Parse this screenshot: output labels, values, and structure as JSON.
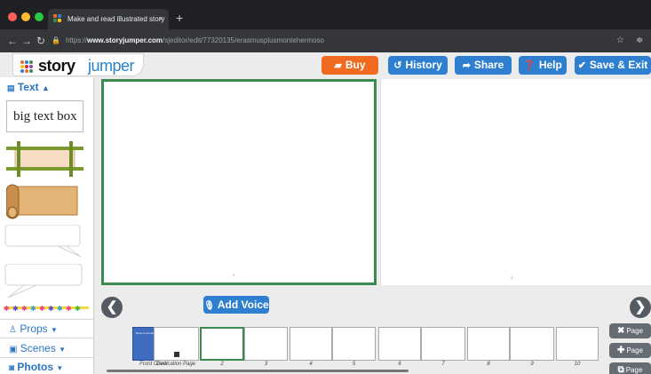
{
  "browser": {
    "tab_title": "Make and read illustrated story",
    "tab_close": "×",
    "new_tab": "+",
    "url_scheme": "https://",
    "url_host": "www.storyjumper.com",
    "url_path": "/sjeditor/edit/77320135/erasmusplusmontehermoso",
    "colors": {
      "close": "#ff5f57",
      "minimize": "#febc2e",
      "maximize": "#28c840"
    }
  },
  "header": {
    "logo_story": "story",
    "logo_jumper": "jumper",
    "buy": "Buy",
    "history": "History",
    "share": "Share",
    "help": "Help",
    "save_exit": "Save & Exit"
  },
  "palette": {
    "text_header": "Text",
    "text_box_sample": "big text box",
    "props": "Props",
    "scenes": "Scenes",
    "photos": "Photos"
  },
  "editor": {
    "left_page_number": "2",
    "right_page_number": "3",
    "add_voice": "Add Voice"
  },
  "thumbnails": {
    "cover_title": "Book of proverbs and sayings",
    "labels": [
      "Front Cover",
      "Dedication Page",
      "2",
      "3",
      "4",
      "5",
      "6",
      "7",
      "8",
      "9",
      "10"
    ],
    "dedication_tiny": "xxxx"
  },
  "page_buttons": {
    "delete": "Page",
    "add": "Page",
    "copy": "Page"
  },
  "colors": {
    "accent_blue": "#2f7fd0",
    "buy_orange": "#f06a1f",
    "selected_green": "#3c8a4f",
    "cover_blue": "#3d6cc0"
  }
}
